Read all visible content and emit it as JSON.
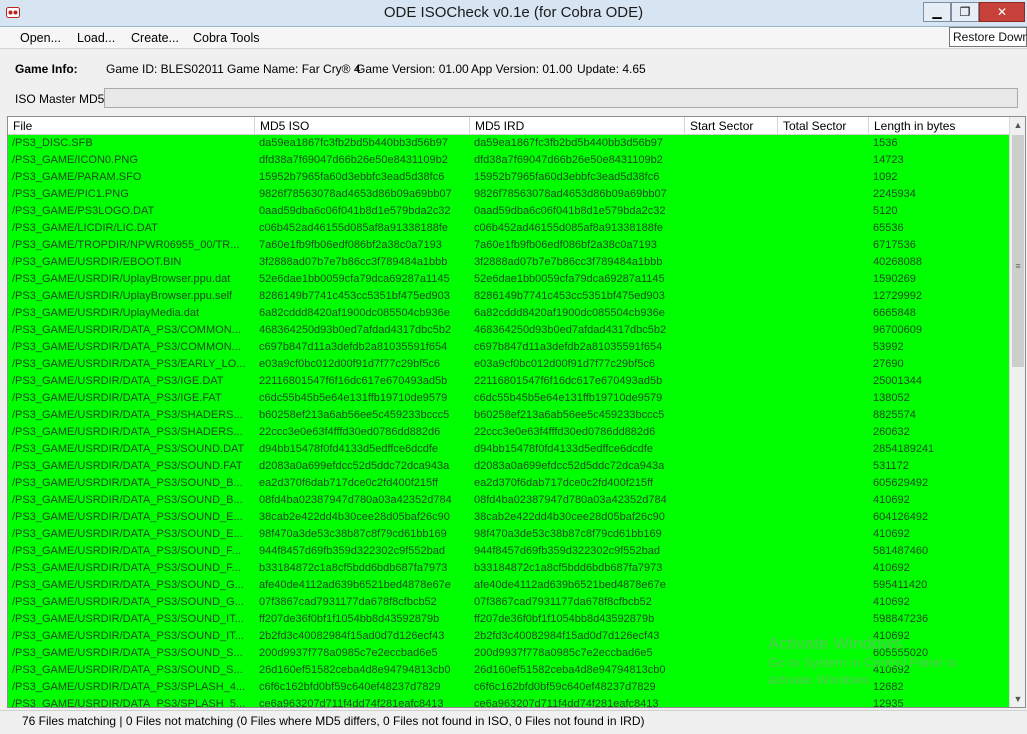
{
  "window": {
    "title": "ODE ISOCheck v0.1e (for Cobra ODE)",
    "min_glyph": "▁",
    "max_glyph": "❐",
    "close_glyph": "✕",
    "tooltip": "Restore Down"
  },
  "menu": [
    "Open...",
    "Load...",
    "Create...",
    "Cobra Tools"
  ],
  "info": {
    "label": "Game Info:",
    "game_id": "Game ID: BLES02011",
    "game_name": "Game Name: Far Cry® 4",
    "game_version": "Game Version: 01.00",
    "app_version": "App Version: 01.00",
    "update": "Update: 4.65"
  },
  "md5": {
    "label": "ISO Master MD5:",
    "value": ""
  },
  "grid": {
    "columns": [
      "File",
      "MD5 ISO",
      "MD5 IRD",
      "Start Sector",
      "Total Sector",
      "Length in bytes"
    ],
    "row_color": "#00ff00",
    "rows": [
      [
        "/PS3_DISC.SFB",
        "da59ea1867fc3fb2bd5b440bb3d56b97",
        "da59ea1867fc3fb2bd5b440bb3d56b97",
        "",
        "",
        "1536"
      ],
      [
        "/PS3_GAME/ICON0.PNG",
        "dfd38a7f69047d66b26e50e8431109b2",
        "dfd38a7f69047d66b26e50e8431109b2",
        "",
        "",
        "14723"
      ],
      [
        "/PS3_GAME/PARAM.SFO",
        "15952b7965fa60d3ebbfc3ead5d38fc6",
        "15952b7965fa60d3ebbfc3ead5d38fc6",
        "",
        "",
        "1092"
      ],
      [
        "/PS3_GAME/PIC1.PNG",
        "9826f78563078ad4653d86b09a69bb07",
        "9826f78563078ad4653d86b09a69bb07",
        "",
        "",
        "2245934"
      ],
      [
        "/PS3_GAME/PS3LOGO.DAT",
        "0aad59dba6c06f041b8d1e579bda2c32",
        "0aad59dba6c06f041b8d1e579bda2c32",
        "",
        "",
        "5120"
      ],
      [
        "/PS3_GAME/LICDIR/LIC.DAT",
        "c06b452ad46155d085af8a91338188fe",
        "c06b452ad46155d085af8a91338188fe",
        "",
        "",
        "65536"
      ],
      [
        "/PS3_GAME/TROPDIR/NPWR06955_00/TR...",
        "7a60e1fb9fb06edf086bf2a38c0a7193",
        "7a60e1fb9fb06edf086bf2a38c0a7193",
        "",
        "",
        "6717536"
      ],
      [
        "/PS3_GAME/USRDIR/EBOOT.BIN",
        "3f2888ad07b7e7b86cc3f789484a1bbb",
        "3f2888ad07b7e7b86cc3f789484a1bbb",
        "",
        "",
        "40268088"
      ],
      [
        "/PS3_GAME/USRDIR/UplayBrowser.ppu.dat",
        "52e6dae1bb0059cfa79dca69287a1145",
        "52e6dae1bb0059cfa79dca69287a1145",
        "",
        "",
        "1590269"
      ],
      [
        "/PS3_GAME/USRDIR/UplayBrowser.ppu.self",
        "8286149b7741c453cc5351bf475ed903",
        "8286149b7741c453cc5351bf475ed903",
        "",
        "",
        "12729992"
      ],
      [
        "/PS3_GAME/USRDIR/UplayMedia.dat",
        "6a82cddd8420af1900dc085504cb936e",
        "6a82cddd8420af1900dc085504cb936e",
        "",
        "",
        "6665848"
      ],
      [
        "/PS3_GAME/USRDIR/DATA_PS3/COMMON...",
        "468364250d93b0ed7afdad4317dbc5b2",
        "468364250d93b0ed7afdad4317dbc5b2",
        "",
        "",
        "96700609"
      ],
      [
        "/PS3_GAME/USRDIR/DATA_PS3/COMMON...",
        "c697b847d11a3defdb2a81035591f654",
        "c697b847d11a3defdb2a81035591f654",
        "",
        "",
        "53992"
      ],
      [
        "/PS3_GAME/USRDIR/DATA_PS3/EARLY_LO...",
        "e03a9cf0bc012d00f91d7f77c29bf5c6",
        "e03a9cf0bc012d00f91d7f77c29bf5c6",
        "",
        "",
        "27690"
      ],
      [
        "/PS3_GAME/USRDIR/DATA_PS3/IGE.DAT",
        "22116801547f6f16dc617e670493ad5b",
        "22116801547f6f16dc617e670493ad5b",
        "",
        "",
        "25001344"
      ],
      [
        "/PS3_GAME/USRDIR/DATA_PS3/IGE.FAT",
        "c6dc55b45b5e64e131ffb19710de9579",
        "c6dc55b45b5e64e131ffb19710de9579",
        "",
        "",
        "138052"
      ],
      [
        "/PS3_GAME/USRDIR/DATA_PS3/SHADERS...",
        "b60258ef213a6ab56ee5c459233bccc5",
        "b60258ef213a6ab56ee5c459233bccc5",
        "",
        "",
        "8825574"
      ],
      [
        "/PS3_GAME/USRDIR/DATA_PS3/SHADERS...",
        "22ccc3e0e63f4fffd30ed0786dd882d6",
        "22ccc3e0e63f4fffd30ed0786dd882d6",
        "",
        "",
        "260632"
      ],
      [
        "/PS3_GAME/USRDIR/DATA_PS3/SOUND.DAT",
        "d94bb15478f0fd4133d5edffce6dcdfe",
        "d94bb15478f0fd4133d5edffce6dcdfe",
        "",
        "",
        "2854189241"
      ],
      [
        "/PS3_GAME/USRDIR/DATA_PS3/SOUND.FAT",
        "d2083a0a699efdcc52d5ddc72dca943a",
        "d2083a0a699efdcc52d5ddc72dca943a",
        "",
        "",
        "531172"
      ],
      [
        "/PS3_GAME/USRDIR/DATA_PS3/SOUND_B...",
        "ea2d370f6dab717dce0c2fd400f215ff",
        "ea2d370f6dab717dce0c2fd400f215ff",
        "",
        "",
        "605629492"
      ],
      [
        "/PS3_GAME/USRDIR/DATA_PS3/SOUND_B...",
        "08fd4ba02387947d780a03a42352d784",
        "08fd4ba02387947d780a03a42352d784",
        "",
        "",
        "410692"
      ],
      [
        "/PS3_GAME/USRDIR/DATA_PS3/SOUND_E...",
        "38cab2e422dd4b30cee28d05baf26c90",
        "38cab2e422dd4b30cee28d05baf26c90",
        "",
        "",
        "604126492"
      ],
      [
        "/PS3_GAME/USRDIR/DATA_PS3/SOUND_E...",
        "98f470a3de53c38b87c8f79cd61bb169",
        "98f470a3de53c38b87c8f79cd61bb169",
        "",
        "",
        "410692"
      ],
      [
        "/PS3_GAME/USRDIR/DATA_PS3/SOUND_F...",
        "944f8457d69fb359d322302c9f552bad",
        "944f8457d69fb359d322302c9f552bad",
        "",
        "",
        "581487460"
      ],
      [
        "/PS3_GAME/USRDIR/DATA_PS3/SOUND_F...",
        "b33184872c1a8cf5bdd6bdb687fa7973",
        "b33184872c1a8cf5bdd6bdb687fa7973",
        "",
        "",
        "410692"
      ],
      [
        "/PS3_GAME/USRDIR/DATA_PS3/SOUND_G...",
        "afe40de4112ad639b6521bed4878e67e",
        "afe40de4112ad639b6521bed4878e67e",
        "",
        "",
        "595411420"
      ],
      [
        "/PS3_GAME/USRDIR/DATA_PS3/SOUND_G...",
        "07f3867cad7931177da678f8cfbcb52",
        "07f3867cad7931177da678f8cfbcb52",
        "",
        "",
        "410692"
      ],
      [
        "/PS3_GAME/USRDIR/DATA_PS3/SOUND_IT...",
        "ff207de36f0bf1f1054bb8d43592879b",
        "ff207de36f0bf1f1054bb8d43592879b",
        "",
        "",
        "598847236"
      ],
      [
        "/PS3_GAME/USRDIR/DATA_PS3/SOUND_IT...",
        "2b2fd3c40082984f15ad0d7d126ecf43",
        "2b2fd3c40082984f15ad0d7d126ecf43",
        "",
        "",
        "410692"
      ],
      [
        "/PS3_GAME/USRDIR/DATA_PS3/SOUND_S...",
        "200d9937f778a0985c7e2eccbad6e5",
        "200d9937f778a0985c7e2eccbad6e5",
        "",
        "",
        "605555020"
      ],
      [
        "/PS3_GAME/USRDIR/DATA_PS3/SOUND_S...",
        "26d160ef51582ceba4d8e94794813cb0",
        "26d160ef51582ceba4d8e94794813cb0",
        "",
        "",
        "410692"
      ],
      [
        "/PS3_GAME/USRDIR/DATA_PS3/SPLASH_4...",
        "c6f6c162bfd0bf59c640ef48237d7829",
        "c6f6c162bfd0bf59c640ef48237d7829",
        "",
        "",
        "12682"
      ],
      [
        "/PS3_GAME/USRDIR/DATA_PS3/SPLASH_5...",
        "ce6a963207d711f4dd74f281eafc8413",
        "ce6a963207d711f4dd74f281eafc8413",
        "",
        "",
        "12935"
      ]
    ]
  },
  "watermark": {
    "line1": "Activate Windows",
    "line2": "Go to System in Control Panel to",
    "line3": "activate Windows."
  },
  "status": "76 Files matching | 0 Files not matching (0 Files where MD5 differs, 0 Files not found in ISO, 0 Files not found in IRD)"
}
